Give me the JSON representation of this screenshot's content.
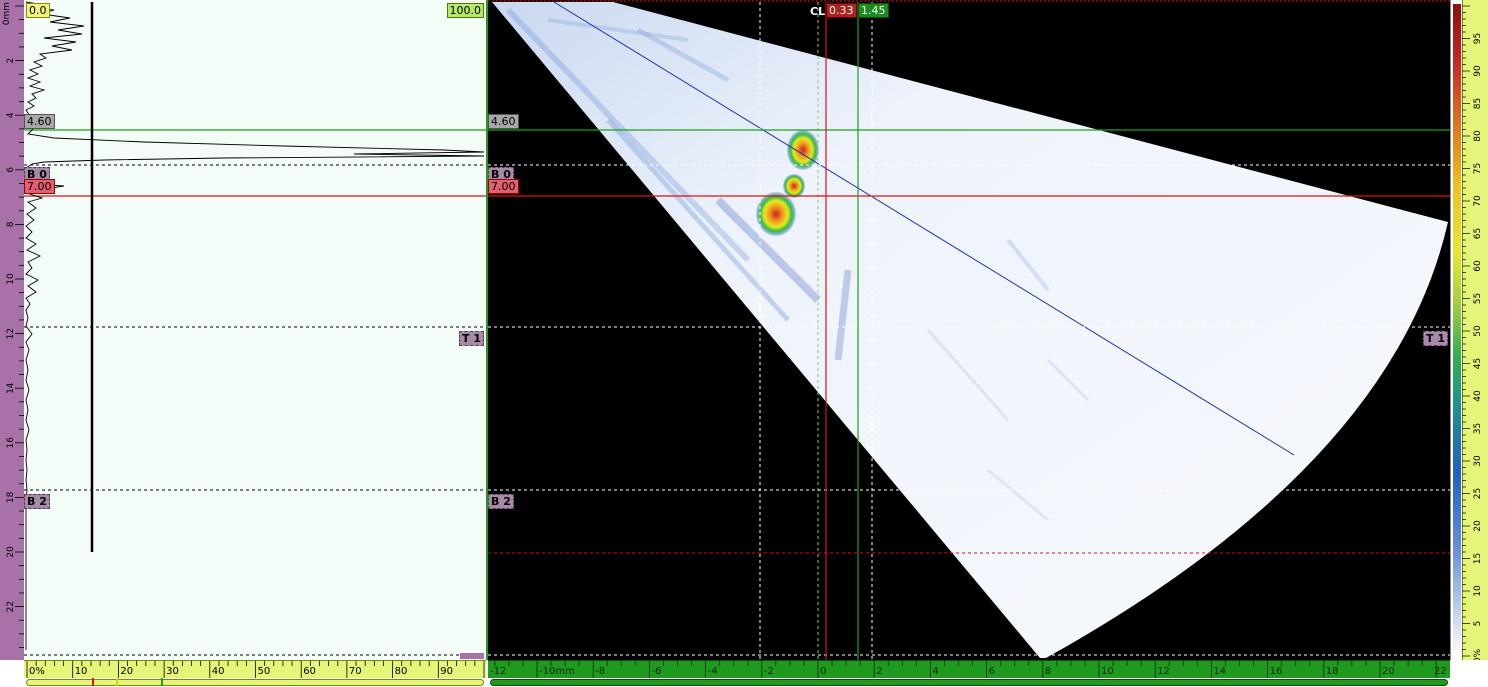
{
  "ascan": {
    "amp_start": "0.0",
    "amp_end": "100.0",
    "ref_label": "4.60",
    "meas_label": "7.00",
    "gate_b0": "B 0",
    "gate_t1": "T 1",
    "gate_b2": "B 2",
    "depth_unit": "0mm",
    "depth_ticks": [
      "2",
      "4",
      "6",
      "8",
      "10",
      "12",
      "14",
      "16",
      "18",
      "20",
      "22"
    ],
    "amp_ticks": [
      "0%",
      "10",
      "20",
      "30",
      "40",
      "50",
      "60",
      "70",
      "80",
      "90"
    ]
  },
  "sscan": {
    "ref_label": "4.60",
    "meas_label": "7.00",
    "gate_b0": "B 0",
    "gate_t1": "T 1",
    "gate_b2": "B 2",
    "cl_label": "CL",
    "cursor_ref": "0.33",
    "cursor_meas": "1.45",
    "index_ticks": [
      "-12",
      "-10mm",
      "-8",
      "-6",
      "-4",
      "-2",
      "0",
      "2",
      "4",
      "6",
      "8",
      "10",
      "12",
      "14",
      "16",
      "18",
      "20",
      "22"
    ]
  },
  "palette": {
    "ticks": [
      "95",
      "90",
      "85",
      "80",
      "75",
      "70",
      "65",
      "60",
      "55",
      "50",
      "45",
      "40",
      "35",
      "30",
      "25",
      "20",
      "15",
      "10",
      "5",
      "0%"
    ]
  },
  "colors": {
    "ref_cursor": "#1aa31a",
    "meas_cursor": "#e01010",
    "ascan_bg": "#f3fcf6",
    "axis_green": "#1f9a1f",
    "ruler_yellow": "#e4f57a",
    "depth_ruler_purple": "#a872a8"
  }
}
